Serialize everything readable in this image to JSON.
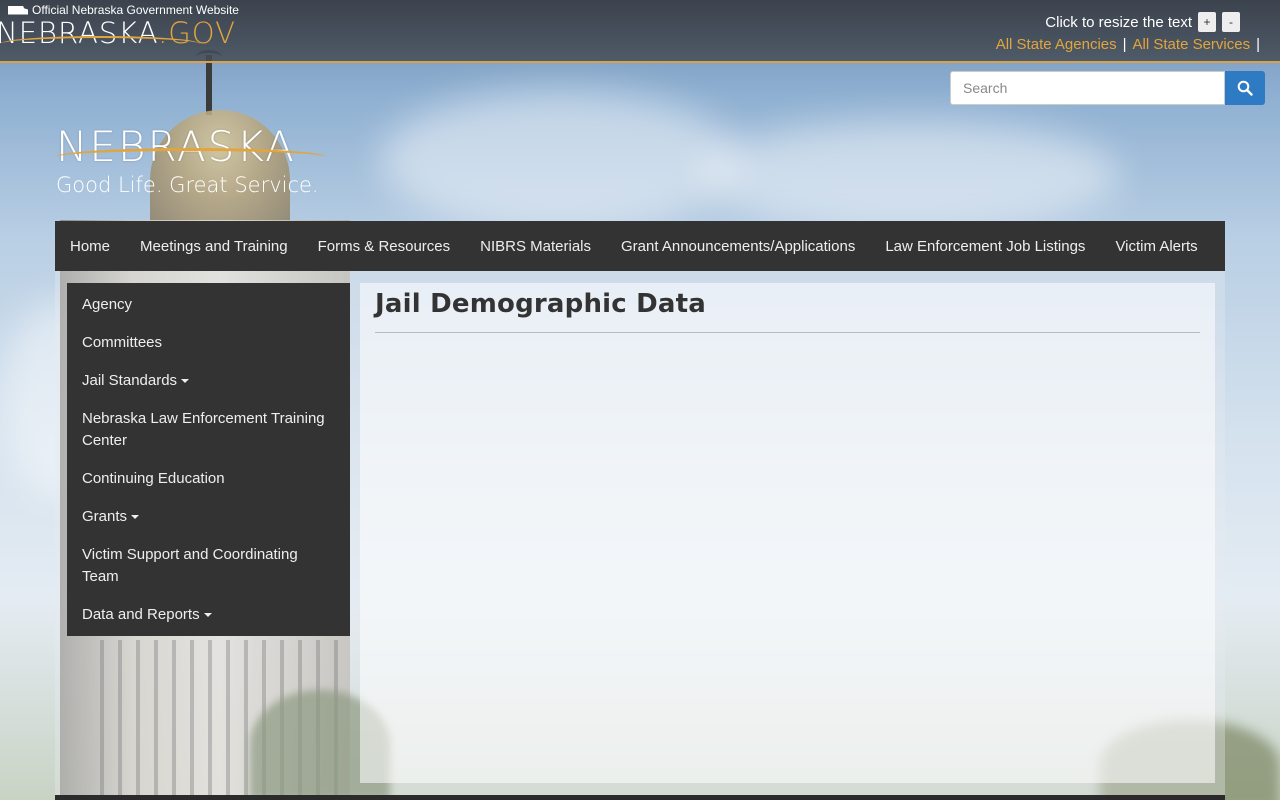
{
  "header": {
    "official_label": "Official Nebraska Government Website",
    "gov_logo_main": "NEBRASKA",
    "gov_logo_suffix": ".GOV",
    "resize_label": "Click to resize the text",
    "resize_plus": "+",
    "resize_minus": "-",
    "state_agencies": "All State Agencies",
    "state_services": "All State Services",
    "separator": "|"
  },
  "search": {
    "placeholder": "Search",
    "icon": "search-icon"
  },
  "brand": {
    "name": "NEBRASKA",
    "tagline": "Good Life. Great Service."
  },
  "mainnav": {
    "items": [
      "Home",
      "Meetings and Training",
      "Forms & Resources",
      "NIBRS Materials",
      "Grant Announcements/Applications",
      "Law Enforcement Job Listings",
      "Victim Alerts"
    ]
  },
  "sidenav": {
    "items": [
      "Agency",
      "Committees",
      "Jail Standards",
      "Nebraska Law Enforcement Training Center",
      "Continuing Education",
      "Grants",
      "Victim Support and Coordinating Team",
      "Data and Reports"
    ]
  },
  "content": {
    "title": "Jail Demographic Data"
  },
  "colors": {
    "accent": "#e2a53d",
    "nav_bg": "#333333",
    "search_button": "#2f7bc3"
  }
}
